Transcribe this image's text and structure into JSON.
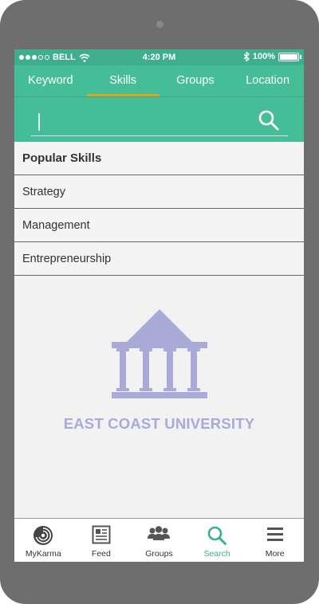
{
  "status_bar": {
    "carrier": "BELL",
    "time": "4:20 PM",
    "battery": "100%",
    "battery_level": 1.0
  },
  "tabs": [
    {
      "label": "Keyword",
      "active": false
    },
    {
      "label": "Skills",
      "active": true
    },
    {
      "label": "Groups",
      "active": false
    },
    {
      "label": "Location",
      "active": false
    }
  ],
  "search": {
    "value": "",
    "icon": "search-icon"
  },
  "list": {
    "header": "Popular Skills",
    "items": [
      "Strategy",
      "Management",
      "Entrepreneurship"
    ]
  },
  "logo": {
    "text": "EAST COAST UNIVERSITY",
    "icon": "university-building-icon",
    "color": "#a9aad8"
  },
  "bottom_nav": [
    {
      "label": "MyKarma",
      "icon": "mykarma-logo-icon",
      "active": false
    },
    {
      "label": "Feed",
      "icon": "feed-icon",
      "active": false
    },
    {
      "label": "Groups",
      "icon": "groups-icon",
      "active": false
    },
    {
      "label": "Search",
      "icon": "search-icon",
      "active": true
    },
    {
      "label": "More",
      "icon": "menu-icon",
      "active": false
    }
  ],
  "colors": {
    "primary": "#45bd96",
    "status_bar": "#3fae8c",
    "tab_indicator": "#d8a623",
    "logo": "#a9aad8"
  }
}
